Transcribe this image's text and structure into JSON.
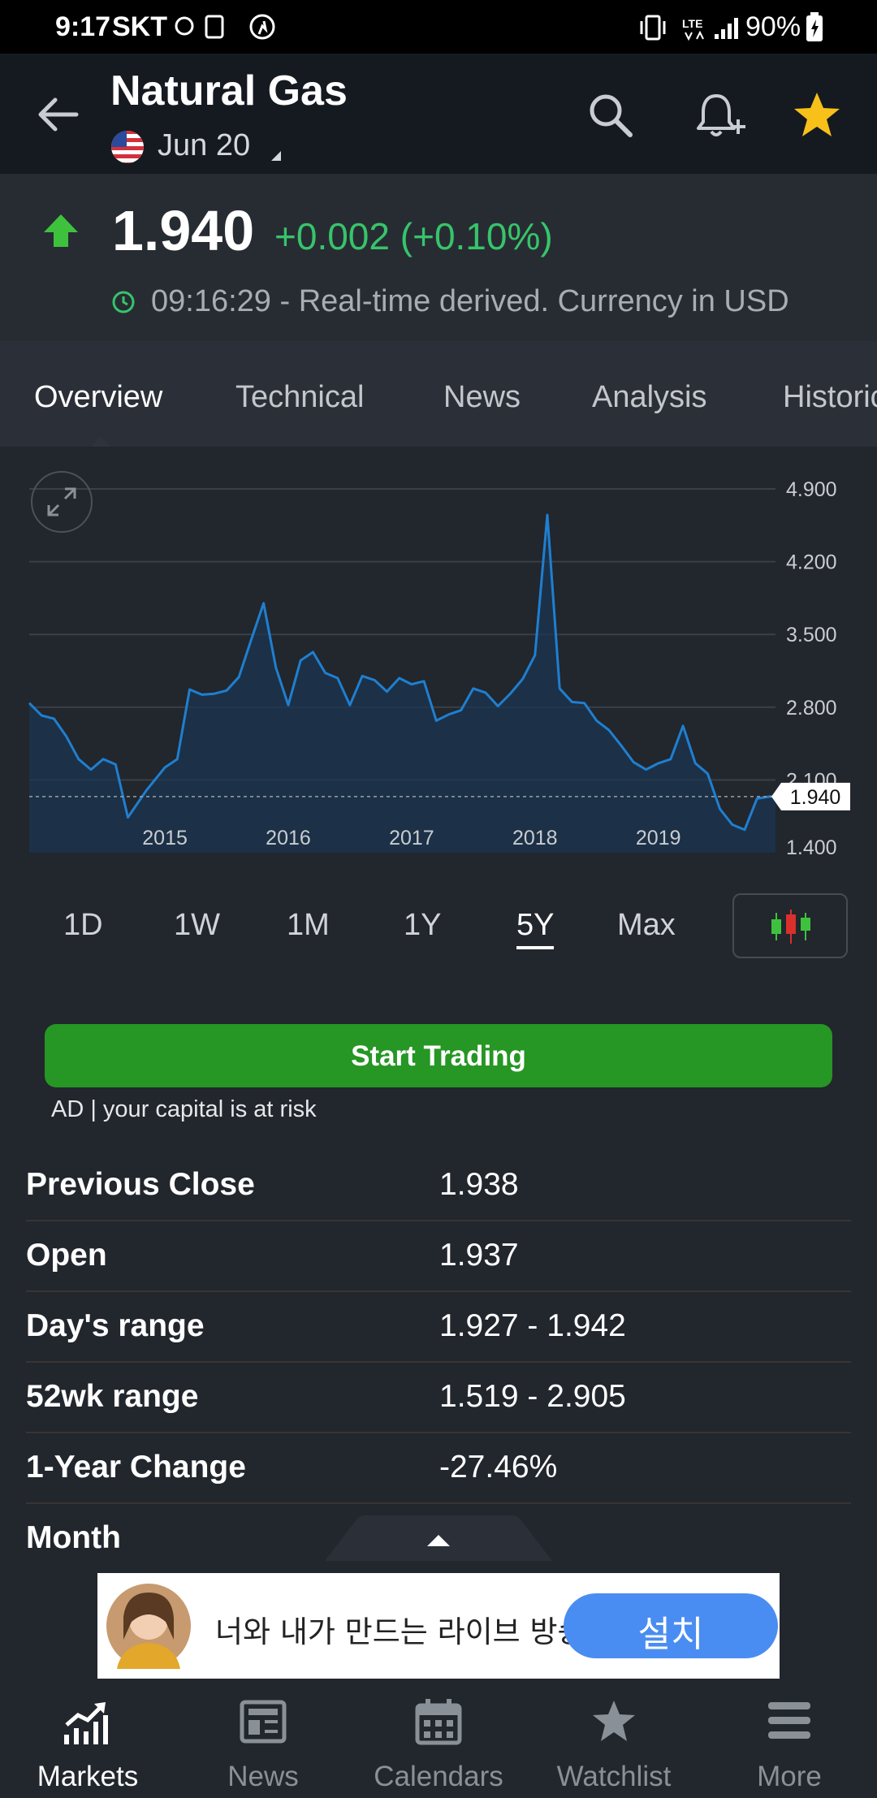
{
  "status_bar": {
    "time": "9:17",
    "carrier": "SKT",
    "battery": "90%"
  },
  "header": {
    "title": "Natural Gas",
    "contract": "Jun 20"
  },
  "quote": {
    "price": "1.940",
    "change": "+0.002 (+0.10%)",
    "realtime_note": "09:16:29 - Real-time derived. Currency in USD",
    "up_color": "#37c46a"
  },
  "tabs": [
    {
      "label": "Overview",
      "active": true
    },
    {
      "label": "Technical"
    },
    {
      "label": "News"
    },
    {
      "label": "Analysis"
    },
    {
      "label": "Historical Data"
    }
  ],
  "chart_data": {
    "type": "area",
    "x_labels": [
      "2015",
      "2016",
      "2017",
      "2018",
      "2019"
    ],
    "y_ticks": [
      "4.900",
      "4.200",
      "3.500",
      "2.800",
      "2.100",
      "1.400"
    ],
    "ylim": [
      1.4,
      4.9
    ],
    "current_value_label": "1.940",
    "current_value": 1.94,
    "line_color": "#1f7fd0",
    "x": [
      2014.4,
      2014.5,
      2014.6,
      2014.7,
      2014.8,
      2014.9,
      2015.0,
      2015.1,
      2015.2,
      2015.35,
      2015.5,
      2015.6,
      2015.7,
      2015.8,
      2015.9,
      2016.0,
      2016.1,
      2016.2,
      2016.3,
      2016.4,
      2016.5,
      2016.6,
      2016.7,
      2016.8,
      2016.9,
      2017.0,
      2017.1,
      2017.2,
      2017.3,
      2017.4,
      2017.5,
      2017.6,
      2017.7,
      2017.8,
      2017.9,
      2018.0,
      2018.1,
      2018.2,
      2018.3,
      2018.4,
      2018.5,
      2018.6,
      2018.7,
      2018.8,
      2018.9,
      2019.0,
      2019.1,
      2019.2,
      2019.3,
      2019.4,
      2019.5,
      2019.6,
      2019.7,
      2019.8,
      2019.9,
      2020.0,
      2020.1,
      2020.2,
      2020.3,
      2020.4,
      2020.45
    ],
    "values": [
      2.84,
      2.72,
      2.69,
      2.52,
      2.3,
      2.2,
      2.3,
      2.25,
      1.74,
      2.0,
      2.22,
      2.3,
      2.97,
      2.92,
      2.93,
      2.96,
      3.09,
      3.45,
      3.8,
      3.18,
      2.82,
      3.25,
      3.33,
      3.13,
      3.08,
      2.82,
      3.1,
      3.06,
      2.95,
      3.08,
      3.02,
      3.05,
      2.67,
      2.73,
      2.77,
      2.98,
      2.94,
      2.81,
      2.93,
      3.07,
      3.3,
      4.65,
      2.98,
      2.85,
      2.84,
      2.67,
      2.58,
      2.43,
      2.27,
      2.2,
      2.26,
      2.3,
      2.62,
      2.26,
      2.16,
      1.82,
      1.67,
      1.62,
      1.92,
      1.94,
      1.94
    ],
    "xlim": [
      2014.4,
      2020.45
    ]
  },
  "ranges": [
    {
      "label": "1D"
    },
    {
      "label": "1W"
    },
    {
      "label": "1M"
    },
    {
      "label": "1Y"
    },
    {
      "label": "5Y",
      "active": true
    },
    {
      "label": "Max"
    }
  ],
  "trade": {
    "button": "Start Trading",
    "disclaimer": "AD | your capital is at risk"
  },
  "stats": [
    {
      "label": "Previous Close",
      "value": "1.938"
    },
    {
      "label": "Open",
      "value": "1.937"
    },
    {
      "label": "Day's range",
      "value": "1.927 - 1.942"
    },
    {
      "label": "52wk range",
      "value": "1.519 - 2.905"
    },
    {
      "label": "1-Year Change",
      "value": "-27.46%"
    },
    {
      "label": "Month",
      "value": ""
    }
  ],
  "ad": {
    "text": "너와 내가 만드는 라이브 방송",
    "button": "설치"
  },
  "nav": [
    {
      "label": "Markets",
      "icon": "markets-icon",
      "active": true
    },
    {
      "label": "News",
      "icon": "news-icon"
    },
    {
      "label": "Calendars",
      "icon": "calendar-icon"
    },
    {
      "label": "Watchlist",
      "icon": "star-icon"
    },
    {
      "label": "More",
      "icon": "menu-icon"
    }
  ]
}
